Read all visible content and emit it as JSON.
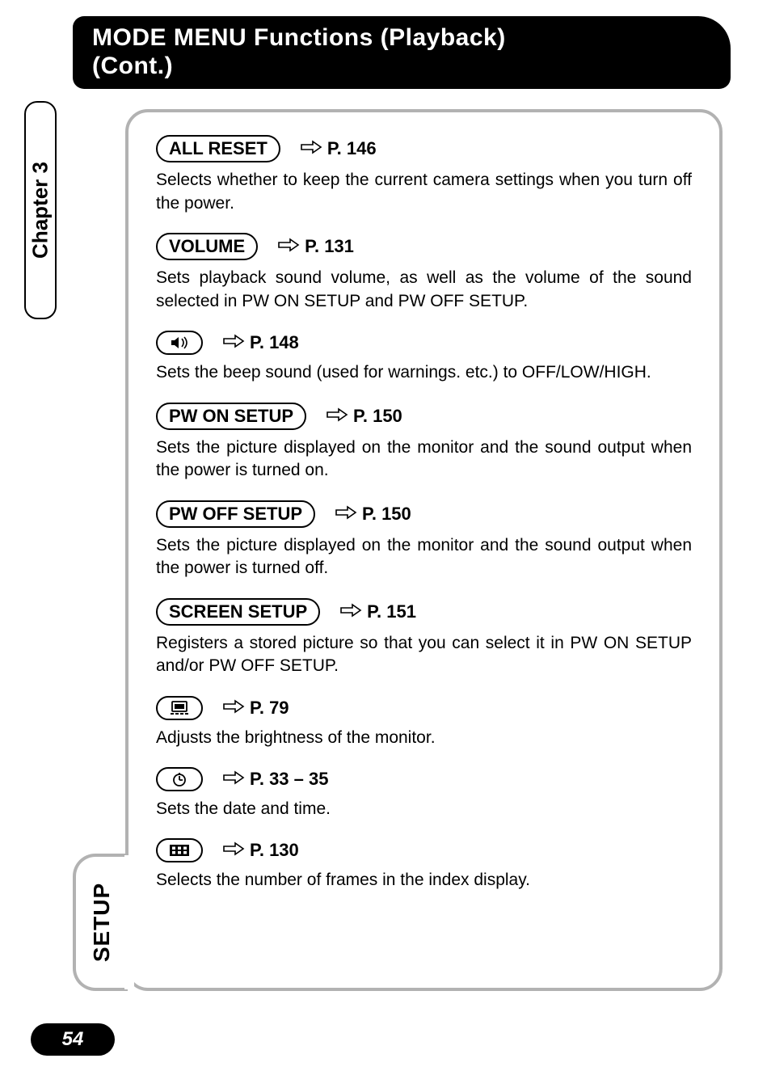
{
  "header": {
    "title_line1": "MODE MENU Functions (Playback)",
    "title_line2": "(Cont.)"
  },
  "chapter_tab": "Chapter 3",
  "setup_tab": "SETUP",
  "page_number": "54",
  "items": [
    {
      "label": "ALL RESET",
      "page_ref": "P. 146",
      "desc": "Selects whether to keep the current camera settings when you turn off the power.",
      "icon": null
    },
    {
      "label": "VOLUME",
      "page_ref": "P. 131",
      "desc": "Sets playback sound volume, as well as the volume of the sound selected in PW ON SETUP and PW OFF SETUP.",
      "icon": null
    },
    {
      "label": null,
      "page_ref": "P. 148",
      "desc": "Sets the beep sound (used for warnings. etc.) to OFF/LOW/HIGH.",
      "icon": "beep"
    },
    {
      "label": "PW ON SETUP",
      "page_ref": "P. 150",
      "desc": "Sets the picture displayed on the monitor and the sound output when the power is turned on.",
      "icon": null
    },
    {
      "label": "PW OFF SETUP",
      "page_ref": "P. 150",
      "desc": "Sets the picture displayed on the monitor and the sound output when the power is turned off.",
      "icon": null
    },
    {
      "label": "SCREEN SETUP",
      "page_ref": "P. 151",
      "desc": "Registers a stored picture so that you can select it in PW ON SETUP and/or PW OFF SETUP.",
      "icon": null
    },
    {
      "label": null,
      "page_ref": "P. 79",
      "desc": "Adjusts the brightness of the monitor.",
      "icon": "brightness"
    },
    {
      "label": null,
      "page_ref": "P. 33 – 35",
      "desc": "Sets the date and time.",
      "icon": "clock"
    },
    {
      "label": null,
      "page_ref": "P. 130",
      "desc": "Selects the number of frames in the index display.",
      "icon": "index"
    }
  ]
}
